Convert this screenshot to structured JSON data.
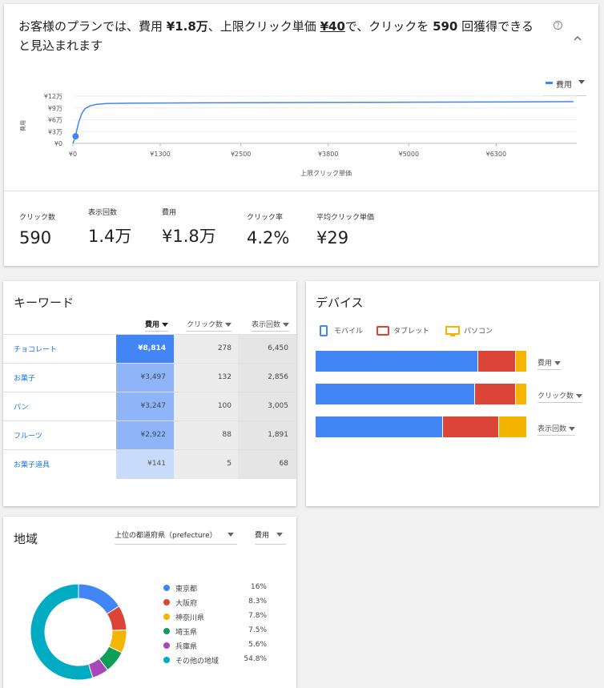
{
  "forecast": {
    "headline": {
      "prefix": "お客様のプランでは、費用 ",
      "cost": "¥1.8万",
      "mid1": "、上限クリック単価 ",
      "max_cpc": "¥40",
      "mid2": "で、クリックを ",
      "clicks": "590",
      "suffix": " 回獲得できると見込まれます"
    },
    "help_icon": "question-circle-icon",
    "collapse_icon": "chevron-up-icon",
    "legend_select_label": "費用",
    "chart_data": {
      "type": "line",
      "xlabel": "上限クリック単価",
      "ylabel": "費用",
      "x_ticks": [
        "¥0",
        "¥1300",
        "¥2500",
        "¥3800",
        "¥5000",
        "¥6300"
      ],
      "y_ticks": [
        "¥0",
        "¥3万",
        "¥6万",
        "¥9万",
        "¥12万"
      ],
      "xlim": [
        0,
        7500
      ],
      "ylim": [
        0,
        120000
      ],
      "series": [
        {
          "name": "費用",
          "color": "#4285f4",
          "x": [
            0,
            40,
            60,
            90,
            130,
            180,
            250,
            350,
            500,
            800,
            1300,
            2000,
            3000,
            4000,
            5000,
            6000,
            7450
          ],
          "y": [
            0,
            18000,
            35000,
            55000,
            75000,
            88000,
            95000,
            99000,
            101000,
            102000,
            102500,
            103000,
            103500,
            104000,
            104500,
            105000,
            106000
          ]
        }
      ],
      "marker": {
        "x": 40,
        "y": 18000
      },
      "grid": true
    },
    "metrics": [
      {
        "label": "クリック数",
        "value": "590"
      },
      {
        "label": "表示回数",
        "value": "1.4万"
      },
      {
        "label": "費用",
        "value": "¥1.8万"
      },
      {
        "label": "クリック率",
        "value": "4.2%"
      },
      {
        "label": "平均クリック単価",
        "value": "¥29"
      }
    ]
  },
  "keywords": {
    "title": "キーワード",
    "headers": {
      "cost": "費用",
      "clicks": "クリック数",
      "impressions": "表示回数"
    },
    "rows": [
      {
        "keyword": "チョコレート",
        "cost": "¥8,814",
        "clicks": "278",
        "impressions": "6,450",
        "cost_share": 1.0
      },
      {
        "keyword": "お菓子",
        "cost": "¥3,497",
        "clicks": "132",
        "impressions": "2,856",
        "cost_share": 0.4
      },
      {
        "keyword": "パン",
        "cost": "¥3,247",
        "clicks": "100",
        "impressions": "3,005",
        "cost_share": 0.37
      },
      {
        "keyword": "フルーツ",
        "cost": "¥2,922",
        "clicks": "88",
        "impressions": "1,891",
        "cost_share": 0.33
      },
      {
        "keyword": "お菓子道具",
        "cost": "¥141",
        "clicks": "5",
        "impressions": "68",
        "cost_share": 0.02
      }
    ]
  },
  "devices": {
    "title": "デバイス",
    "legend": [
      {
        "label": "モバイル",
        "color": "#4285f4",
        "icon": "mobile-icon"
      },
      {
        "label": "タブレット",
        "color": "#db4437",
        "icon": "tablet-icon"
      },
      {
        "label": "パソコン",
        "color": "#f4b400",
        "icon": "desktop-icon"
      }
    ],
    "bars": [
      {
        "metric": "費用",
        "shares": [
          0.77,
          0.18,
          0.05
        ]
      },
      {
        "metric": "クリック数",
        "shares": [
          0.755,
          0.195,
          0.05
        ]
      },
      {
        "metric": "表示回数",
        "shares": [
          0.605,
          0.265,
          0.13
        ]
      }
    ]
  },
  "regions": {
    "title": "地域",
    "level_select": "上位の都道府県（prefecture）",
    "metric_select": "費用",
    "items": [
      {
        "name": "東京都",
        "pct": "16%",
        "value": 16,
        "color": "#4285f4"
      },
      {
        "name": "大阪府",
        "pct": "8.3%",
        "value": 8.3,
        "color": "#db4437"
      },
      {
        "name": "神奈川県",
        "pct": "7.8%",
        "value": 7.8,
        "color": "#f4b400"
      },
      {
        "name": "埼玉県",
        "pct": "7.5%",
        "value": 7.5,
        "color": "#0f9d58"
      },
      {
        "name": "兵庫県",
        "pct": "5.6%",
        "value": 5.6,
        "color": "#ab47bc"
      },
      {
        "name": "その他の地域",
        "pct": "54.8%",
        "value": 54.8,
        "color": "#00acc1"
      }
    ]
  }
}
